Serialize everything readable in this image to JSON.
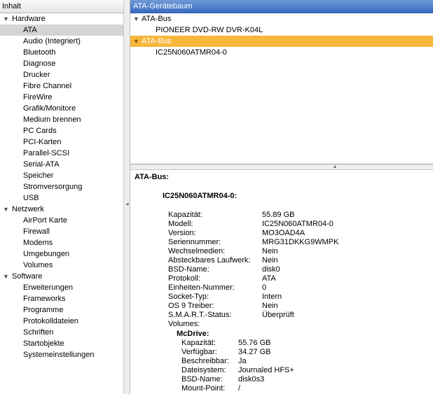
{
  "sidebar": {
    "header": "Inhalt",
    "groups": [
      {
        "label": "Hardware",
        "items": [
          "ATA",
          "Audio (Integriert)",
          "Bluetooth",
          "Diagnose",
          "Drucker",
          "Fibre Channel",
          "FireWire",
          "Grafik/Monitore",
          "Medium brennen",
          "PC Cards",
          "PCI-Karten",
          "Parallel-SCSI",
          "Serial-ATA",
          "Speicher",
          "Stromversorgung",
          "USB"
        ]
      },
      {
        "label": "Netzwerk",
        "items": [
          "AirPort Karte",
          "Firewall",
          "Modems",
          "Umgebungen",
          "Volumes"
        ]
      },
      {
        "label": "Software",
        "items": [
          "Erweiterungen",
          "Frameworks",
          "Programme",
          "Protokolldateien",
          "Schriften",
          "Startobjekte",
          "Systemeinstellungen"
        ]
      }
    ],
    "selected_item": "ATA"
  },
  "tree": {
    "header": "ATA-Gerätebaum",
    "buses": [
      {
        "label": "ATA-Bus",
        "device": "PIONEER DVD-RW  DVR-K04L",
        "selected": false
      },
      {
        "label": "ATA-Bus",
        "device": "IC25N060ATMR04-0",
        "selected": true
      }
    ]
  },
  "details": {
    "title": "ATA-Bus:",
    "device": "IC25N060ATMR04-0:",
    "properties": [
      {
        "key": "Kapazität:",
        "value": "55.89 GB"
      },
      {
        "key": "Modell:",
        "value": "IC25N060ATMR04-0"
      },
      {
        "key": "Version:",
        "value": "MO3OAD4A"
      },
      {
        "key": "Seriennummer:",
        "value": "MRG31DKKG9WMPK"
      },
      {
        "key": "Wechselmedien:",
        "value": "Nein"
      },
      {
        "key": "Absteckbares Laufwerk:",
        "value": "Nein"
      },
      {
        "key": "BSD-Name:",
        "value": "disk0"
      },
      {
        "key": "Protokoll:",
        "value": "ATA"
      },
      {
        "key": "Einheiten-Nummer:",
        "value": "0"
      },
      {
        "key": "Socket-Typ:",
        "value": "Intern"
      },
      {
        "key": "OS 9 Treiber:",
        "value": "Nein"
      },
      {
        "key": "S.M.A.R.T.-Status:",
        "value": "Überprüft"
      },
      {
        "key": "Volumes:",
        "value": ""
      }
    ],
    "volume": {
      "name": "McDrive:",
      "properties": [
        {
          "key": "Kapazität:",
          "value": "55.76 GB"
        },
        {
          "key": "Verfügbar:",
          "value": "34.27 GB"
        },
        {
          "key": "Beschreibbar:",
          "value": "Ja"
        },
        {
          "key": "Dateisystem:",
          "value": "Journaled HFS+"
        },
        {
          "key": "BSD-Name:",
          "value": "disk0s3"
        },
        {
          "key": "Mount-Point:",
          "value": "/"
        }
      ]
    }
  },
  "icons": {
    "expanded": "triangle-down-icon",
    "splitter": "splitter-handle-icon"
  },
  "colors": {
    "selection_orange": "#f6b73c",
    "header_blue": "#3a6cc2",
    "sidebar_selection": "#d4d4d4"
  }
}
